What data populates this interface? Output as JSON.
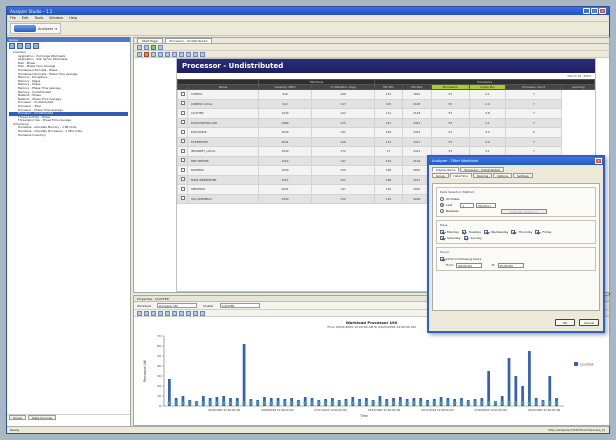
{
  "window": {
    "title": "Analyzer Studio – 1.1"
  },
  "menu": [
    "File",
    "Edit",
    "Tools",
    "Window",
    "Help"
  ],
  "main_button": "Analyzer",
  "left_panel": {
    "header": "Scope",
    "tree": [
      {
        "label": "Counters",
        "level": 0
      },
      {
        "label": "Application - Exchange Workloads",
        "level": 1
      },
      {
        "label": "Application - SQL Server Workloads",
        "level": 1
      },
      {
        "label": "Disk - Phase",
        "level": 1
      },
      {
        "label": "Disk - Phase Time Average",
        "level": 1
      },
      {
        "label": "Hardware Interrupts - Phase",
        "level": 1
      },
      {
        "label": "Hardware Interrupts - Phase Time Average",
        "level": 1
      },
      {
        "label": "Memory - Exceptions",
        "level": 1
      },
      {
        "label": "Memory - Pages",
        "level": 1
      },
      {
        "label": "Memory - Phase",
        "level": 1
      },
      {
        "label": "Memory - Phase Time Average",
        "level": 1
      },
      {
        "label": "Memory - Undistributed",
        "level": 1
      },
      {
        "label": "Network - Phase",
        "level": 1
      },
      {
        "label": "Network - Phase Time Average",
        "level": 1
      },
      {
        "label": "Processor - Undistributed",
        "level": 1
      },
      {
        "label": "Processor - Total",
        "level": 1
      },
      {
        "label": "Processor - Phase Time Average",
        "level": 1
      },
      {
        "label": "Processor - Undistributed",
        "level": 1,
        "selected": true
      },
      {
        "label": "Thread Activity - Phase",
        "level": 1
      },
      {
        "label": "Threadpool Use - Phase Time Average",
        "level": 1
      },
      {
        "label": "Scheduling",
        "level": 0
      },
      {
        "label": "Hardware - Allocable Memory - 4 KB Units",
        "level": 1
      },
      {
        "label": "Hardware - Allocable Processors - 1 Mhz Units",
        "level": 1
      },
      {
        "label": "Hardware Inventory",
        "level": 1
      }
    ],
    "tabs": [
      "Scope",
      "Data Sources"
    ]
  },
  "doc_tabs": [
    "Start Page",
    "Processor - Undistributed"
  ],
  "report": {
    "title": "Processor - Undistributed",
    "date": "March 25, 2005",
    "group_headers": [
      "Machines",
      "Processors"
    ],
    "columns": [
      "",
      "Name",
      "Capacity (MHz)",
      "% Utilization (Avg)",
      "Util Min",
      "Util Max",
      "Processors",
      "Active Min",
      "Processor Count",
      "Load Avg"
    ],
    "rows": [
      [
        "CORE01",
        "916",
        "108",
        "101",
        "1821",
        "53",
        "2.1",
        "7"
      ],
      [
        "CORE02 LOCAL",
        "912",
        "117",
        "105",
        "2143",
        "53",
        "2.4",
        "7"
      ],
      [
        "CLUSTER",
        "1240",
        "122",
        "111",
        "2118",
        "53",
        "3.8",
        "7"
      ],
      [
        "DATACONTROLLER",
        "1480",
        "175",
        "211",
        "3411",
        "53",
        "4.1",
        "7"
      ],
      [
        "EXCHANGE",
        "2040",
        "141",
        "149",
        "3414",
        "53",
        "4.2",
        "6"
      ],
      [
        "FILESERVER",
        "2041",
        "156",
        "131",
        "3411",
        "53",
        "4.4",
        "7"
      ],
      [
        "INTRANET_LOCAL",
        "1930",
        "172",
        "17",
        "4411",
        "53",
        "4.1",
        "7"
      ],
      [
        "HRP SERVER",
        "1412",
        "147",
        "104",
        "4116",
        "53",
        "4.2",
        "7"
      ],
      [
        "MAPPING",
        "1940",
        "150",
        "108",
        "3801",
        "53",
        "3.8",
        "7"
      ],
      [
        "MAIN WEBSERVER",
        "1411",
        "151",
        "108",
        "4211",
        "53",
        "4.2",
        "7"
      ],
      [
        "SERVER01",
        "2041",
        "147",
        "105",
        "3910",
        "53",
        "3.9",
        "7"
      ],
      [
        "SQL SERVER01",
        "1930",
        "152",
        "110",
        "4004",
        "53",
        "4.0",
        "7"
      ]
    ]
  },
  "properties": {
    "header": "Properties - CLUSTER",
    "field1_label": "Workload",
    "field1_value": "Processor Util",
    "field2_label": "Cluster",
    "field2_value": "CLUSTER"
  },
  "chart_data": {
    "type": "bar",
    "title": "Workload Processor Util",
    "subtitle": "From 03/01/2005 12:00:00 AM To 03/25/2005 12:00:00 AM",
    "xlabel": "Time",
    "ylabel": "Processor Util",
    "x_tick_labels": [
      "03/05/2005 12:00:00 AM",
      "03/08/2005 12:00:00 AM",
      "03/11/2005 12:00:00 AM",
      "03/14/2005 12:00:00 AM",
      "03/17/2005 12:00:00 AM",
      "03/20/2005 12:00:00 AM",
      "03/23/2005 12:00:00 AM"
    ],
    "ylim": [
      0,
      70
    ],
    "legend": "CLUSTER",
    "legend_position": "right",
    "values": [
      27,
      8,
      10,
      6,
      5,
      10,
      8,
      9,
      10,
      8,
      8,
      62,
      7,
      6,
      9,
      8,
      8,
      7,
      8,
      6,
      9,
      8,
      6,
      7,
      8,
      6,
      7,
      9,
      7,
      8,
      6,
      10,
      7,
      8,
      9,
      7,
      8,
      8,
      6,
      7,
      9,
      8,
      7,
      8,
      6,
      7,
      8,
      35,
      5,
      10,
      48,
      30,
      20,
      55,
      8,
      6,
      30,
      8
    ]
  },
  "dialog": {
    "title": "Analyzer - Filter Workload",
    "tabs_row1": [
      "Display Name",
      "Processor - Undistributed"
    ],
    "tabs_row2": [
      "Group",
      "Date/Time",
      "Ranking",
      "Options",
      "Settings"
    ],
    "date_group_label": "Date Selection Method",
    "opt_all": "All Dates",
    "opt_last": "Last",
    "last_value": "1",
    "last_unit": "Month(s)",
    "opt_between": "Between",
    "between_button": "Calendar Selection...",
    "days_group_label": "Days",
    "days": [
      "Monday",
      "Tuesday",
      "Wednesday",
      "Thursday",
      "Friday",
      "Saturday",
      "Sunday"
    ],
    "hours_group_label": "Hours",
    "hours_check": "Limit to following hours",
    "from_label": "From",
    "from_value": "08:00 AM",
    "to_label": "To",
    "to_value": "05:00 PM",
    "ok": "OK",
    "cancel": "Cancel"
  },
  "status": {
    "left": "Ready",
    "right": "http://analyzer/[?DS?Tools?Servers_2]"
  }
}
